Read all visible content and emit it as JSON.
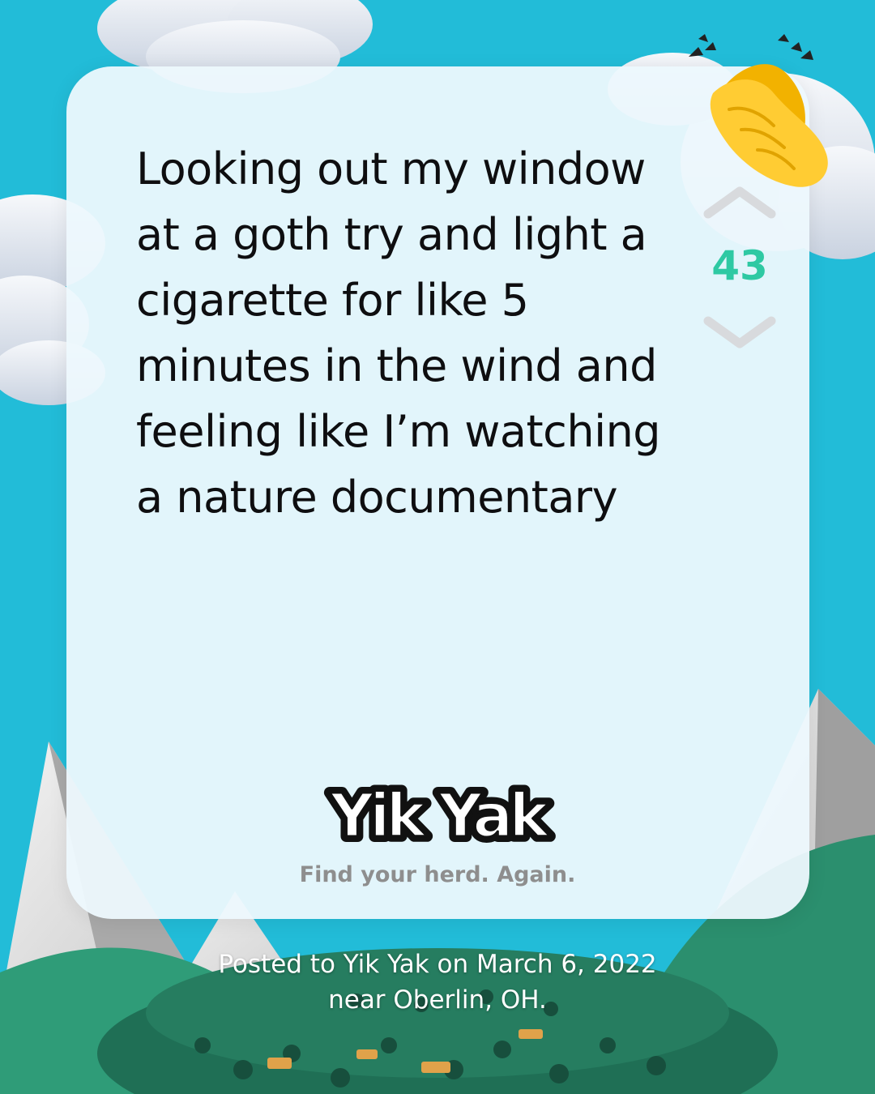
{
  "post": {
    "text": "Looking out my window at a goth try and light a cigarette for like 5 minutes in the wind and feeling like I’m watching a nature documentary",
    "vote_count": "43"
  },
  "brand": {
    "logo_text": "Yik Yak",
    "tagline": "Find your herd. Again."
  },
  "footer": {
    "line1": "Posted to Yik Yak on March 6, 2022",
    "line2": "near Oberlin, OH."
  },
  "icons": {
    "upvote": "chevron-up-icon",
    "downvote": "chevron-down-icon",
    "reaction": "clapping-hands-icon"
  },
  "colors": {
    "background": "#22bcd8",
    "card": "#edf8fd",
    "vote_count": "#2ec9a3",
    "text": "#0e0e10",
    "tagline": "#8e8e8e",
    "mountain_green": "#2f9c78"
  }
}
